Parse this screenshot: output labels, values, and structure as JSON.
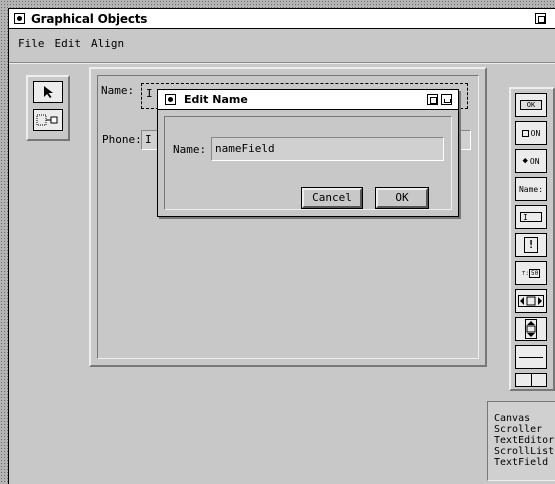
{
  "window": {
    "title": "Graphical Objects"
  },
  "menubar": {
    "items": [
      "File",
      "Edit",
      "Align"
    ]
  },
  "canvas": {
    "name_label": "Name:",
    "phone_label": "Phone:",
    "name_field_value": "I",
    "phone_field_value": "I"
  },
  "dialog": {
    "title": "Edit Name",
    "name_label": "Name:",
    "name_value": "nameField",
    "cancel_label": "Cancel",
    "ok_label": "OK"
  },
  "palette": {
    "ok_button": "OK",
    "on_label_1": "ON",
    "on_label_2": "ON",
    "name_label": "Name:",
    "textfield_glyph": "I",
    "alert_glyph": "!",
    "slider_label": "50"
  },
  "class_list": {
    "items": [
      "Canvas",
      "Scroller",
      "TextEditor",
      "ScrollList",
      "TextField"
    ]
  },
  "colors": {
    "background": "#c8c8c8",
    "title_bar": "#ffffff",
    "desktop": "#b4b4b4"
  }
}
